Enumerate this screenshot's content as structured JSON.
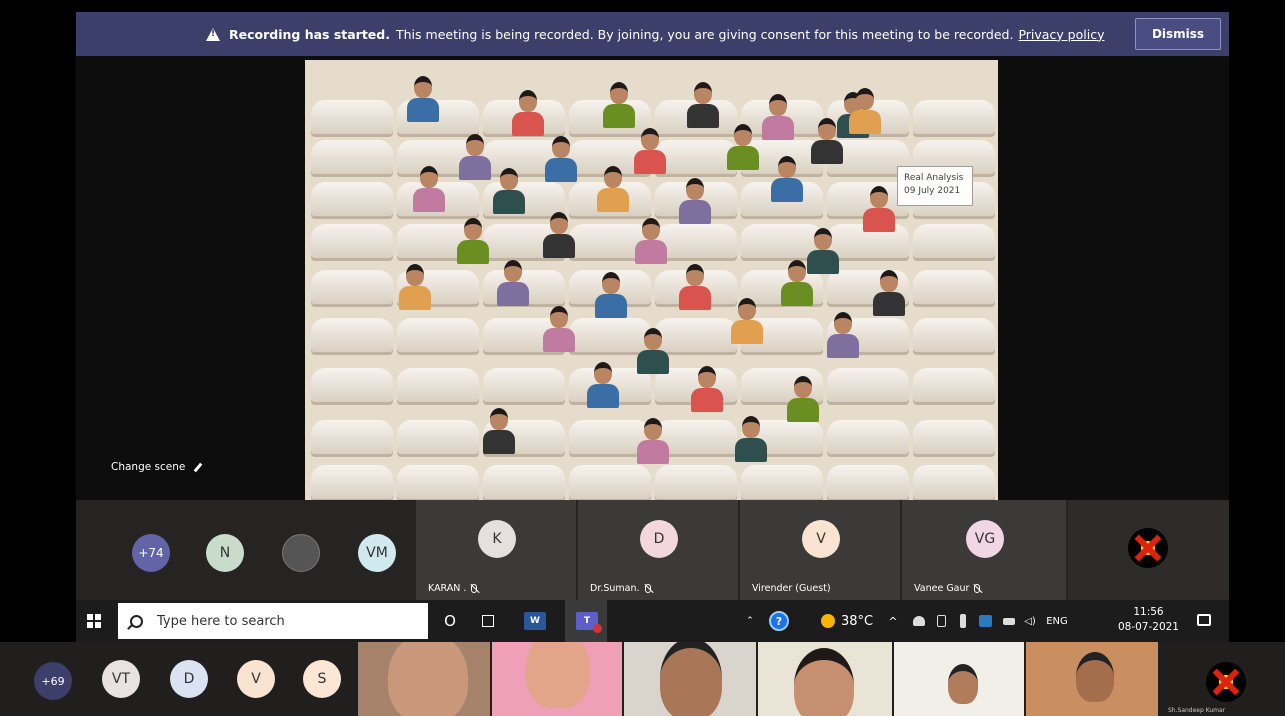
{
  "banner": {
    "heading": "Recording has started.",
    "message": "This meeting is being recorded. By joining, you are giving consent for this meeting to be recorded.",
    "link": "Privacy policy",
    "dismiss": "Dismiss"
  },
  "stage": {
    "scene_label_line1": "Real Analysis",
    "scene_label_line2": "09 July 2021",
    "change_scene": "Change scene"
  },
  "participants": {
    "overflow": "+74",
    "avatars": [
      {
        "initials": "N",
        "color": "#c9dccc"
      },
      {
        "initials": "VM",
        "color": "#cfe9ee"
      }
    ],
    "tiles": [
      {
        "initials": "K",
        "name": "KARAN .",
        "color": "#e6e0dc"
      },
      {
        "initials": "D",
        "name": "Dr.Suman.",
        "color": "#f4d7dc"
      },
      {
        "initials": "V",
        "name": "Virender (Guest)",
        "color": "#fbe3d1"
      },
      {
        "initials": "VG",
        "name": "Vanee Gaur",
        "color": "#f1d6e6"
      }
    ]
  },
  "taskbar": {
    "search_placeholder": "Type here to search",
    "cortana": "O",
    "word": "W",
    "teams": "T",
    "help": "?",
    "temperature": "38°C",
    "language": "ENG",
    "time": "11:56",
    "date": "08-07-2021"
  },
  "bottom": {
    "overflow": "+69",
    "avatars": [
      {
        "initials": "VT",
        "color": "#e8e3e0"
      },
      {
        "initials": "D",
        "color": "#dbe3f3"
      },
      {
        "initials": "V",
        "color": "#fbe3d1"
      },
      {
        "initials": "S",
        "color": "#fde6d3"
      }
    ],
    "name": "Sh.Sandeep Kumar"
  },
  "colors": {
    "banner_bg": "#3d3f6b",
    "overflow_badge": "#6264a7",
    "stage_bg": "#e6dccb"
  }
}
